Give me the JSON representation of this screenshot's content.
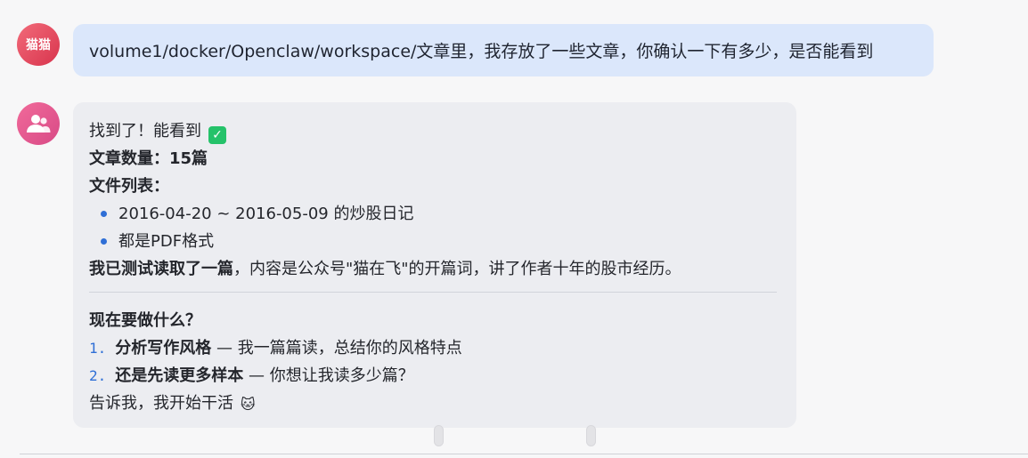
{
  "user_message": {
    "avatar_label": "猫猫",
    "text": "volume1/docker/Openclaw/workspace/文章里，我存放了一些文章，你确认一下有多少，是否能看到"
  },
  "bot_message": {
    "found_text": "找到了！能看到",
    "check_icon": "✓",
    "count_label": "文章数量：",
    "count_value": "15篇",
    "files_label": "文件列表：",
    "files": [
      "2016-04-20 ~ 2016-05-09 的炒股日记",
      "都是PDF格式"
    ],
    "test_bold": "我已测试读取了一篇",
    "test_rest": "，内容是公众号\"猫在飞\"的开篇词，讲了作者十年的股市经历。",
    "question": "现在要做什么？",
    "options": [
      {
        "num": "1.",
        "bold": "分析写作风格",
        "rest": " — 我一篇篇读，总结你的风格特点"
      },
      {
        "num": "2.",
        "bold": "还是先读更多样本",
        "rest": " — 你想让我读多少篇？"
      }
    ],
    "closing_text": "告诉我，我开始干活",
    "cat_icon": "🐱"
  }
}
